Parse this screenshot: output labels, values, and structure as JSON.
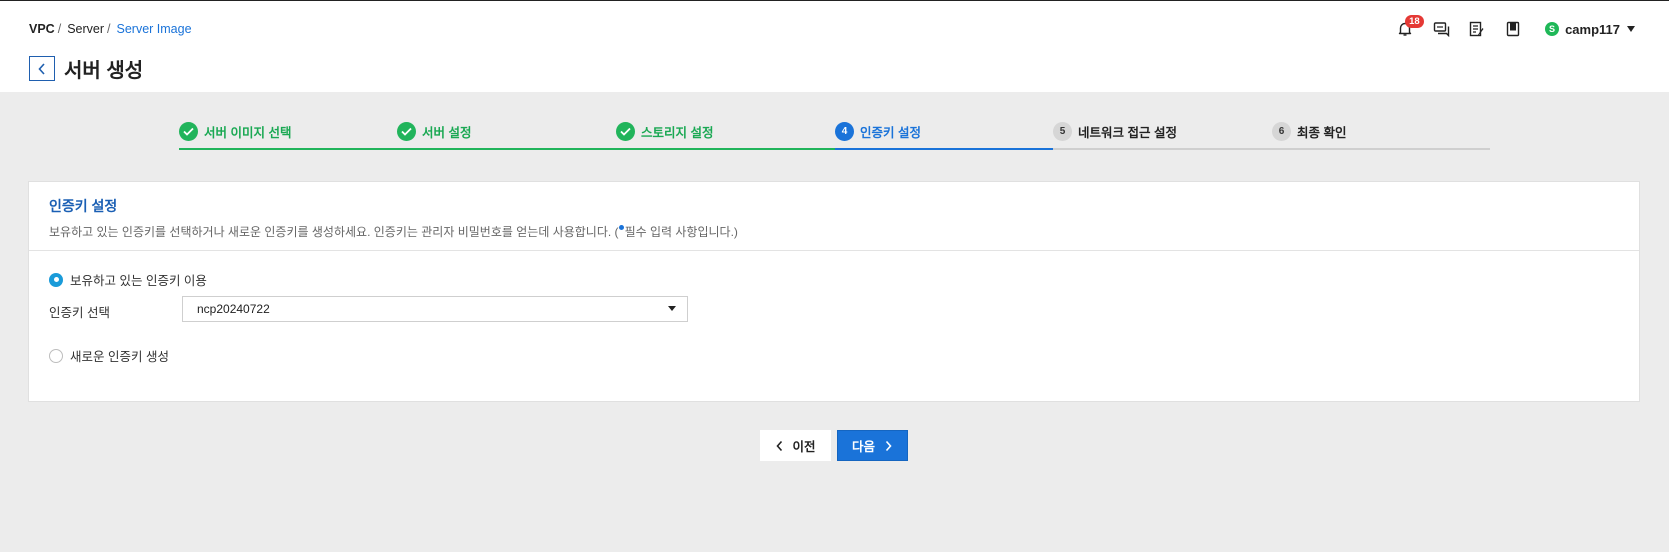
{
  "breadcrumb": {
    "items": [
      "VPC",
      "Server",
      "Server Image"
    ],
    "separator": "/"
  },
  "header": {
    "title": "서버 생성",
    "notification_count": "18",
    "user": {
      "initial": "S",
      "name": "camp117"
    },
    "icons": [
      "bell-icon",
      "chat-icon",
      "edit-note-icon",
      "book-icon"
    ]
  },
  "stepper": {
    "steps": [
      {
        "number": "1",
        "label": "서버 이미지 선택",
        "state": "done"
      },
      {
        "number": "2",
        "label": "서버 설정",
        "state": "done"
      },
      {
        "number": "3",
        "label": "스토리지 설정",
        "state": "done"
      },
      {
        "number": "4",
        "label": "인증키 설정",
        "state": "active"
      },
      {
        "number": "5",
        "label": "네트워크 접근 설정",
        "state": "pending"
      },
      {
        "number": "6",
        "label": "최종 확인",
        "state": "pending"
      }
    ]
  },
  "card": {
    "title": "인증키 설정",
    "desc_main": "보유하고 있는 인증키를 선택하거나 새로운 인증키를 생성하세요. 인증키는 관리자 비밀번호를 얻는데 사용합니다. (",
    "desc_required": "필수 입력 사항입니다.)",
    "option_existing": "보유하고 있는 인증키 이용",
    "select_label": "인증키 선택",
    "select_value": "ncp20240722",
    "option_new": "새로운 인증키 생성"
  },
  "buttons": {
    "prev": "이전",
    "next": "다음"
  },
  "colors": {
    "accent": "#1a73d9",
    "done": "#21b45b",
    "badge": "#e53935"
  }
}
